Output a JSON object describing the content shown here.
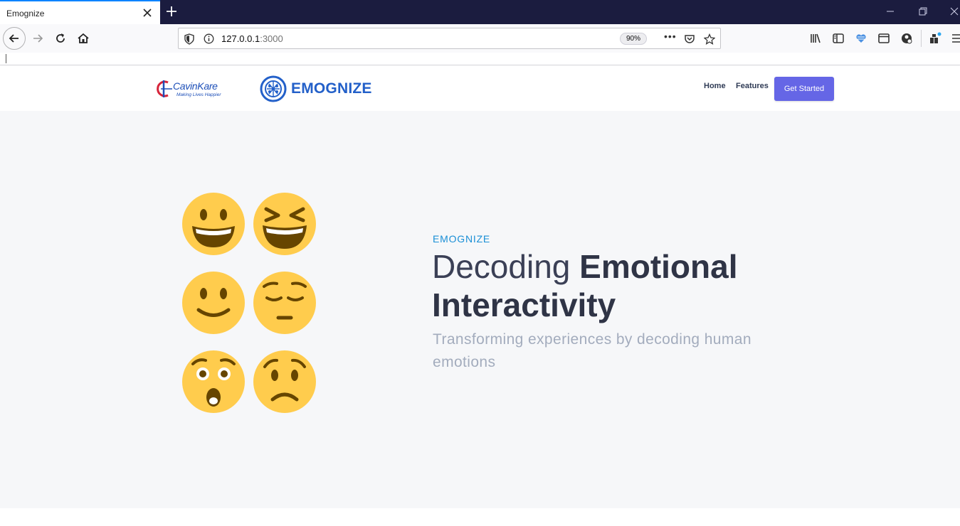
{
  "browser": {
    "tab_title": "Emognize",
    "url_host": "127.0.0.1",
    "url_port": ":3000",
    "zoom": "90%",
    "more_actions": "•••"
  },
  "site": {
    "partner_logo": {
      "name": "CavinKare",
      "tagline": "Making Lives Happier"
    },
    "brand_name": "EMOGNIZE",
    "nav": {
      "home": "Home",
      "features": "Features",
      "cta": "Get Started"
    }
  },
  "hero": {
    "eyebrow": "EMOGNIZE",
    "title_light": "Decoding ",
    "title_bold": "Emotional Interactivity",
    "subtitle": "Transforming experiences by decoding human emotions",
    "emojis": [
      "grinning-face",
      "laughing-squinting-face",
      "slightly-smiling-face",
      "pensive-face",
      "astonished-face",
      "worried-face"
    ]
  },
  "colors": {
    "accent": "#6566e6",
    "brand_blue": "#2360c9",
    "eyebrow_blue": "#1a8fd6",
    "emoji_yellow": "#ffcc4d",
    "emoji_feature": "#664500"
  }
}
